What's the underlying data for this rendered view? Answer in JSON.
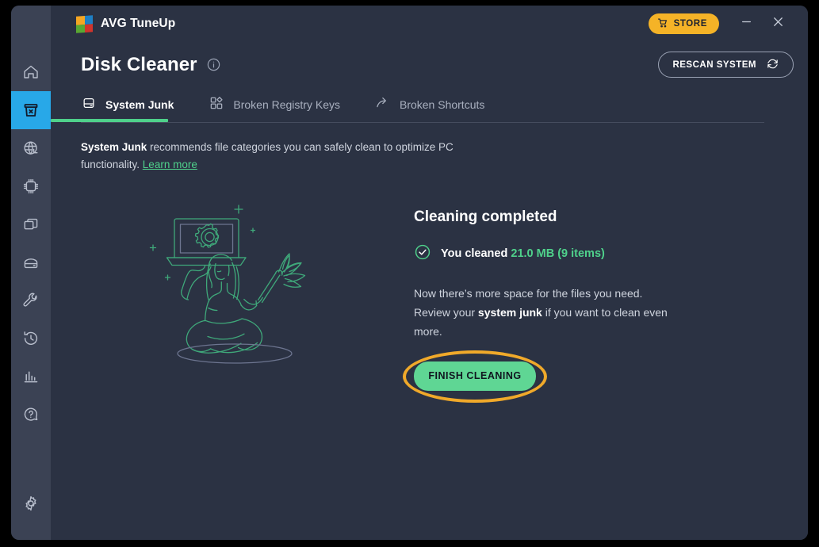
{
  "app": {
    "brand_name": "AVG TuneUp",
    "logo_icon": "avg-logo-icon"
  },
  "titlebar": {
    "store_label": "STORE",
    "store_icon": "shopping-cart-icon",
    "minimize_icon": "minimize-icon",
    "close_icon": "close-icon"
  },
  "header": {
    "page_title": "Disk Cleaner",
    "info_icon": "info-circle-icon",
    "rescan_label": "RESCAN SYSTEM",
    "rescan_icon": "refresh-icon"
  },
  "tabs": [
    {
      "label": "System Junk",
      "icon": "hard-drive-icon",
      "active": true
    },
    {
      "label": "Broken Registry Keys",
      "icon": "registry-squares-icon",
      "active": false
    },
    {
      "label": "Broken Shortcuts",
      "icon": "shortcut-arrow-icon",
      "active": false
    }
  ],
  "description": {
    "bold_lead": "System Junk",
    "body": " recommends file categories you can safely clean to optimize PC functionality. ",
    "link_label": "Learn more"
  },
  "result": {
    "heading": "Cleaning completed",
    "check_icon": "check-circle-icon",
    "cleaned_prefix": "You cleaned ",
    "cleaned_amount": "21.0 MB (9 items)",
    "amount_value": "21.0 MB",
    "items_count": "9 items",
    "body_line1": "Now there’s more space for the files you need.",
    "body_line2_pre": "Review your ",
    "body_line2_bold": "system junk",
    "body_line2_post": " if you want to clean even more.",
    "finish_label": "FINISH CLEANING"
  },
  "sidebar": {
    "items": [
      {
        "name": "home",
        "icon": "home-icon",
        "active": false
      },
      {
        "name": "clean",
        "icon": "trash-bin-icon",
        "active": true
      },
      {
        "name": "speed-up",
        "icon": "globe-speed-icon",
        "active": false
      },
      {
        "name": "performance",
        "icon": "cpu-chip-icon",
        "active": false
      },
      {
        "name": "software-updater",
        "icon": "windows-layers-icon",
        "active": false
      },
      {
        "name": "disk",
        "icon": "hard-drive-icon",
        "active": false
      },
      {
        "name": "tools",
        "icon": "wrench-icon",
        "active": false
      },
      {
        "name": "history",
        "icon": "clock-history-icon",
        "active": false
      },
      {
        "name": "reports",
        "icon": "bar-chart-icon",
        "active": false
      },
      {
        "name": "help",
        "icon": "help-circle-icon",
        "active": false
      }
    ],
    "settings": {
      "name": "settings",
      "icon": "gear-icon"
    }
  },
  "colors": {
    "window_bg": "#2b3243",
    "sidebar_bg": "#3b4254",
    "accent_green": "#4fd18b",
    "accent_blue": "#28a8e8",
    "store_yellow": "#f5b327",
    "annotation_orange": "#f0a92a",
    "illustration_stroke": "#3fa87a"
  },
  "illustration": {
    "name": "woman-with-laptop-and-duster-illustration"
  }
}
